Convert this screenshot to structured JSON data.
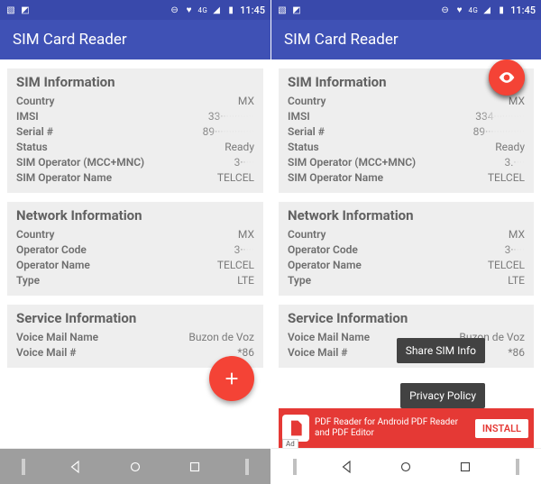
{
  "statusbar": {
    "network_label": "4G",
    "time": "11:45"
  },
  "appbar": {
    "title": "SIM Card Reader"
  },
  "left": {
    "sim": {
      "title": "SIM Information",
      "country_k": "Country",
      "country_v": "MX",
      "imsi_k": "IMSI",
      "imsi_v": "33············",
      "serial_k": "Serial #",
      "serial_v": "89··············",
      "status_k": "Status",
      "status_v": "Ready",
      "mccmnc_k": "SIM Operator (MCC+MNC)",
      "mccmnc_v": "3·····",
      "opname_k": "SIM Operator Name",
      "opname_v": "TELCEL"
    },
    "net": {
      "title": "Network Information",
      "country_k": "Country",
      "country_v": "MX",
      "code_k": "Operator Code",
      "code_v": "3·····",
      "name_k": "Operator Name",
      "name_v": "TELCEL",
      "type_k": "Type",
      "type_v": "LTE"
    },
    "svc": {
      "title": "Service Information",
      "vmn_k": "Voice Mail Name",
      "vmn_v": "Buzon de Voz",
      "vmnum_k": "Voice Mail #",
      "vmnum_v": "*86"
    }
  },
  "right": {
    "sim": {
      "title": "SIM Information",
      "country_k": "Country",
      "country_v": "MX",
      "imsi_k": "IMSI",
      "imsi_v": "334···········",
      "serial_k": "Serial #",
      "serial_v": "89··············",
      "status_k": "Status",
      "status_v": "Ready",
      "mccmnc_k": "SIM Operator (MCC+MNC)",
      "mccmnc_v": "3.····",
      "opname_k": "SIM Operator Name",
      "opname_v": "TELCEL"
    },
    "net": {
      "title": "Network Information",
      "country_k": "Country",
      "country_v": "MX",
      "code_k": "Operator Code",
      "code_v": "3·····",
      "name_k": "Operator Name",
      "name_v": "TELCEL",
      "type_k": "Type",
      "type_v": "LTE"
    },
    "svc": {
      "title": "Service Information",
      "vmn_k": "Voice Mail Name",
      "vmn_v": "Buzon de Voz",
      "vmnum_k": "Voice Mail #",
      "vmnum_v": "*86"
    },
    "fab": {
      "share_label": "Share SIM Info",
      "privacy_label": "Privacy Policy"
    },
    "ad": {
      "text": "PDF Reader for Android PDF Reader and PDF Editor",
      "button": "INSTALL",
      "tag": "Ad"
    }
  }
}
